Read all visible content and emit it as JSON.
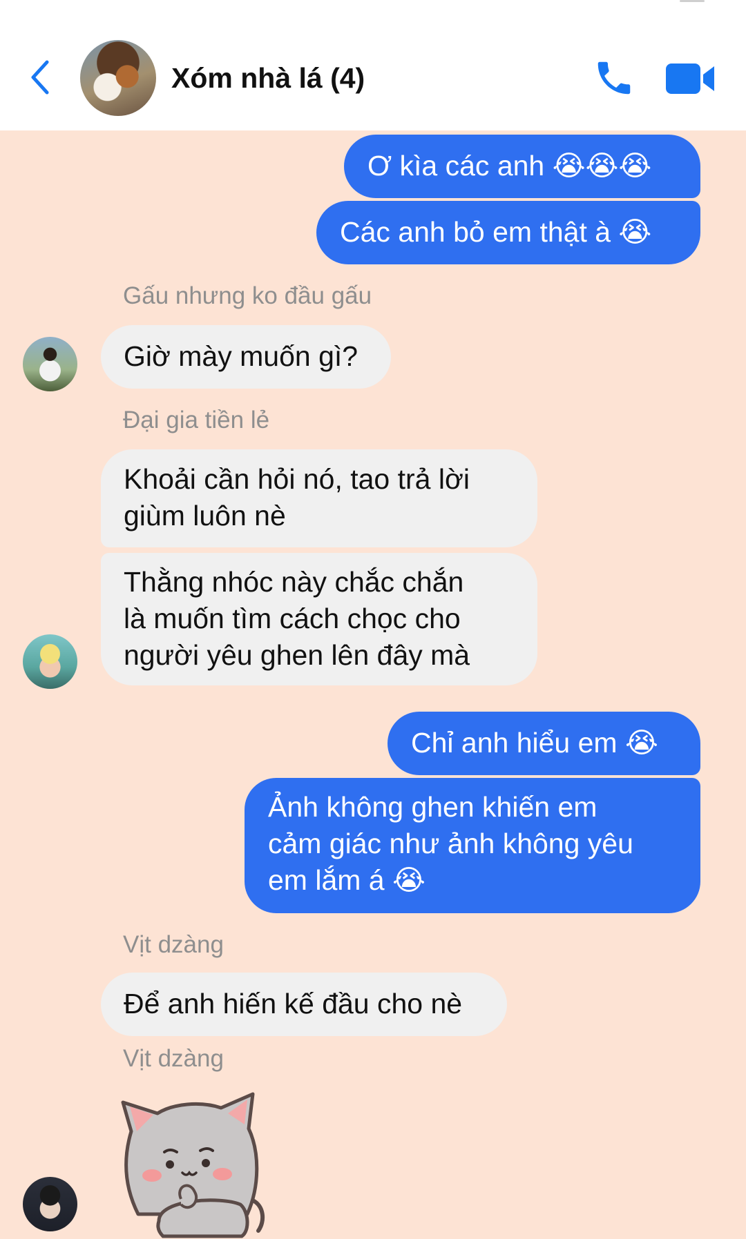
{
  "header": {
    "title": "Xóm nhà lá (4)",
    "back_icon": "chevron-left-icon",
    "call_icon": "phone-icon",
    "video_icon": "video-camera-icon",
    "accent_color": "#1877f2"
  },
  "colors": {
    "background": "#fde3d4",
    "outgoing_bubble": "#2f6ff0",
    "incoming_bubble": "#f0f0f0"
  },
  "messages": [
    {
      "direction": "out",
      "text": "Ơ kìa các anh 😭😭😭"
    },
    {
      "direction": "out",
      "text": "Các anh bỏ em thật à 😭"
    },
    {
      "direction": "in",
      "sender": "Gấu nhưng ko đầu gấu",
      "text": "Giờ mày muốn gì?"
    },
    {
      "direction": "in",
      "sender": "Đại gia tiền lẻ",
      "lines": [
        "Khoải cần hỏi nó, tao trả lời",
        "giùm luôn nè"
      ]
    },
    {
      "direction": "in",
      "lines": [
        "Thằng nhóc này chắc chắn",
        "là muốn tìm cách chọc cho",
        "người yêu ghen lên đây mà"
      ]
    },
    {
      "direction": "out",
      "text": "Chỉ anh hiểu em 😭"
    },
    {
      "direction": "out",
      "lines": [
        "Ảnh không ghen khiến em",
        "cảm giác như ảnh không yêu",
        "em lắm á 😭"
      ]
    },
    {
      "direction": "in",
      "sender": "Vịt dzàng",
      "text": "Để anh hiến kế đầu cho nè"
    },
    {
      "direction": "in",
      "sender": "Vịt dzàng",
      "sticker": "crying-cat-sticker"
    }
  ]
}
